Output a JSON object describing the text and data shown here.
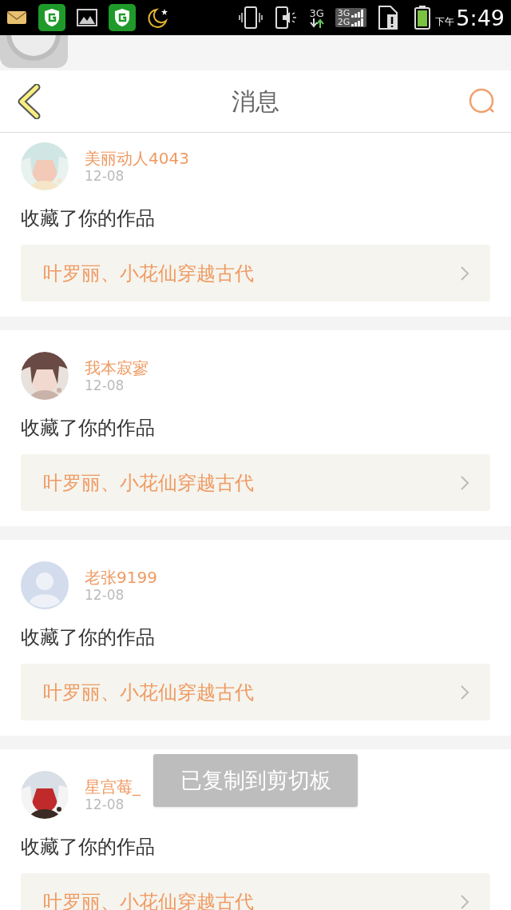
{
  "status_bar": {
    "network": "3G",
    "sim_1": "3G",
    "sim_2": "2G",
    "period": "下午",
    "time": "5:49"
  },
  "header": {
    "title": "消息"
  },
  "messages": [
    {
      "name": "美丽动人4043",
      "date": "12-08",
      "action": "收藏了你的作品",
      "work": "叶罗丽、小花仙穿越古代"
    },
    {
      "name": "我本寂寥",
      "date": "12-08",
      "action": "收藏了你的作品",
      "work": "叶罗丽、小花仙穿越古代"
    },
    {
      "avatar": {
        "kind": "default"
      },
      "name": "老张9199",
      "date": "12-08",
      "action": "收藏了你的作品",
      "work": "叶罗丽、小花仙穿越古代"
    },
    {
      "name": "星宫莓_",
      "date": "12-08",
      "action": "收藏了你的作品",
      "work": "叶罗丽、小花仙穿越古代"
    }
  ],
  "toast": {
    "text": "已复制到剪切板"
  }
}
